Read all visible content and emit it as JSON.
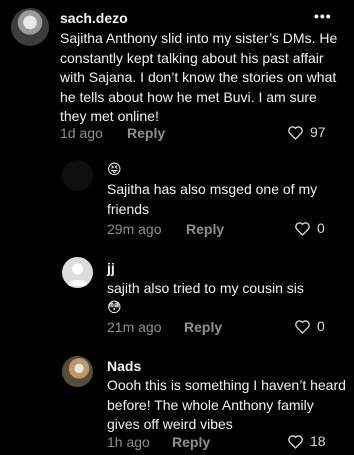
{
  "comments": [
    {
      "username": "sach.dezo",
      "text": "Sajitha Anthony slid into my sister’s DMs. He constantly kept talking about his past affair with Sajana. I don’t know the stories on what he tells about how he met Buvi. I am sure they met online!",
      "time": "1d ago",
      "reply": "Reply",
      "likes": "97",
      "more": "•••"
    },
    {
      "username": "😝",
      "text": "Sajitha has also msged one of my friends",
      "time": "29m ago",
      "reply": "Reply",
      "likes": "0"
    },
    {
      "username": "jj",
      "text": "sajith also tried to my cousin sis",
      "emoji": "😳",
      "time": "21m ago",
      "reply": "Reply",
      "likes": "0"
    },
    {
      "username": "Nads",
      "text": "Oooh this is something I haven’t heard before! The whole Anthony family gives off weird vibes",
      "time": "1h ago",
      "reply": "Reply",
      "likes": "18"
    }
  ]
}
